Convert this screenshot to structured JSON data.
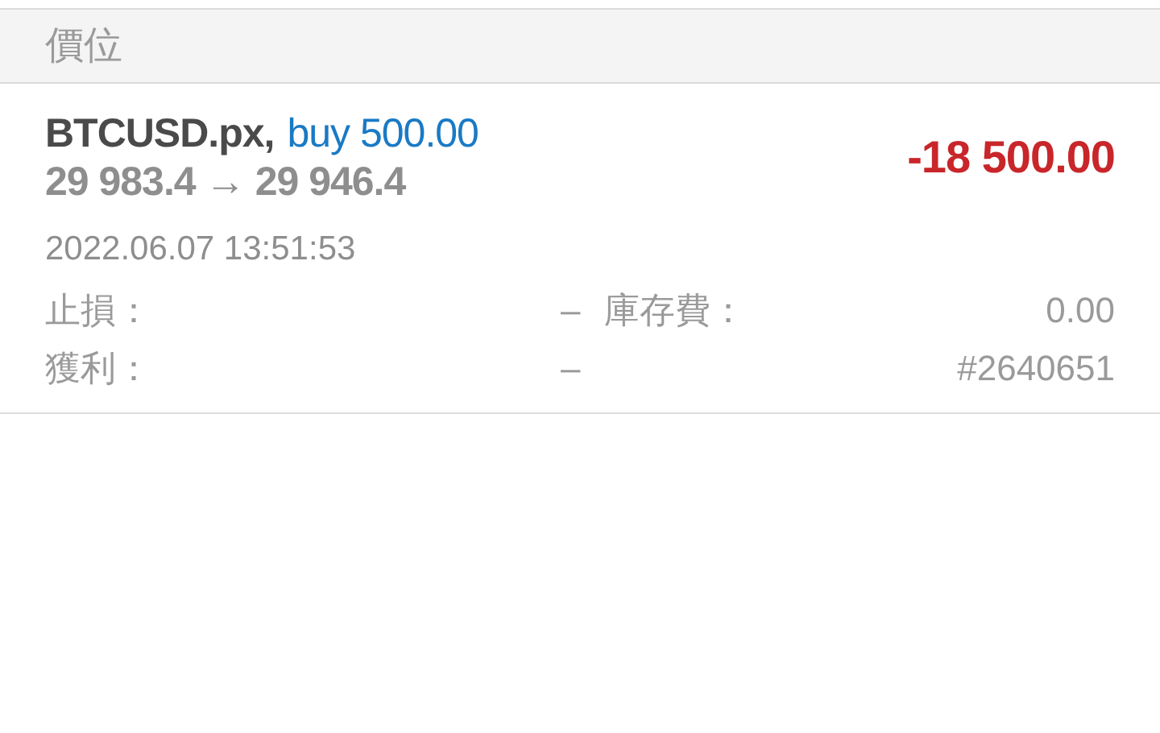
{
  "section_header": "價位",
  "position": {
    "symbol": "BTCUSD.px,",
    "side": "buy 500.00",
    "open_price": "29 983.4",
    "arrow": "→",
    "current_price": "29 946.4",
    "profit": "-18 500.00",
    "time": "2022.06.07 13:51:53",
    "details": [
      {
        "label": "止損：",
        "value": "–",
        "label2": "庫存費：",
        "value2": "0.00"
      },
      {
        "label": "獲利：",
        "value": "–",
        "value2": "#2640651"
      }
    ]
  }
}
